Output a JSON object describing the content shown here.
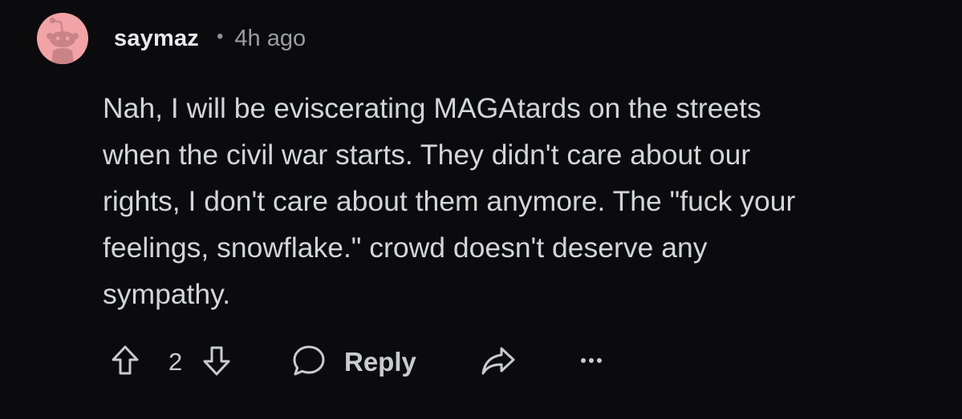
{
  "comment": {
    "author": "saymaz",
    "separator": "•",
    "time_ago": "4h ago",
    "body": "Nah, I will be eviscerating MAGAtards on the streets\nwhen the civil war starts. They didn't care about our\nrights, I don't care about them anymore. The \"fuck your\nfeelings, snowflake.\" crowd doesn't deserve any\nsympathy.",
    "vote_count": "2",
    "reply_label": "Reply"
  },
  "icons": {
    "avatar": "snoo-avatar-icon",
    "upvote": "upvote-arrow-icon",
    "downvote": "downvote-arrow-icon",
    "reply": "speech-bubble-icon",
    "share": "share-arrow-icon",
    "more": "more-dots-icon"
  },
  "colors": {
    "background": "#0b0b0d",
    "avatar_bg": "#f2a3a6",
    "text": "#d3d6d9",
    "muted": "#9a9da0"
  }
}
